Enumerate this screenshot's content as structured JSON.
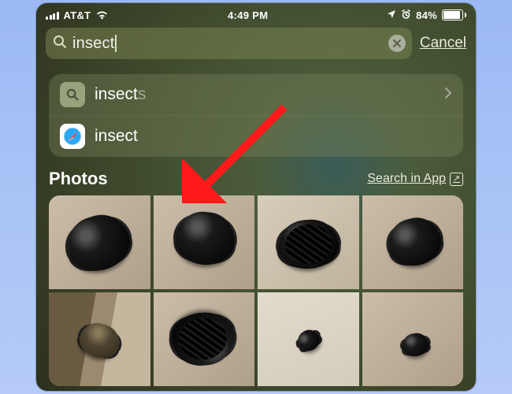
{
  "status": {
    "carrier": "AT&T",
    "time": "4:49 PM",
    "battery_pct": "84%"
  },
  "search": {
    "query": "insect",
    "cancel_label": "Cancel"
  },
  "suggestions": {
    "items": [
      {
        "label_typed": "insect",
        "label_completion": "s",
        "icon": "search-icon"
      },
      {
        "label_typed": "insect",
        "label_completion": "",
        "icon": "safari-icon"
      }
    ]
  },
  "photos_section": {
    "title": "Photos",
    "search_in_app_label": "Search in App",
    "count_visible": 8
  },
  "annotation": {
    "kind": "red-arrow",
    "points_to": "photos-grid"
  }
}
